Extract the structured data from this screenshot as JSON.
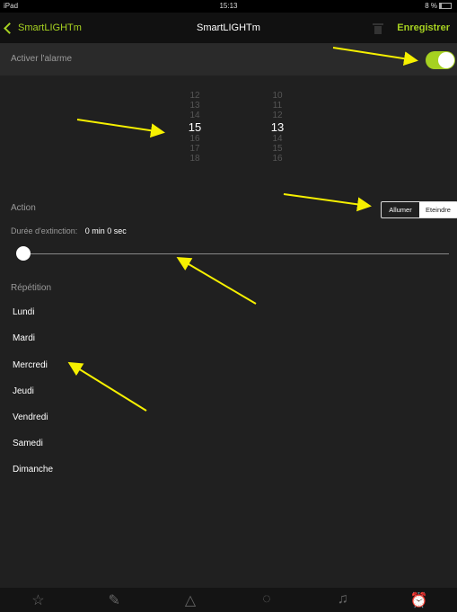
{
  "status_bar": {
    "carrier": "iPad",
    "time": "15:13",
    "battery": "8 %"
  },
  "nav": {
    "back_label": "SmartLIGHTm",
    "title": "SmartLIGHTm",
    "save_label": "Enregistrer"
  },
  "alarm": {
    "label": "Activer l'alarme",
    "enabled": true
  },
  "time_picker": {
    "hours": [
      "12",
      "13",
      "14",
      "15",
      "16",
      "17",
      "18"
    ],
    "minutes": [
      "10",
      "11",
      "12",
      "13",
      "14",
      "15",
      "16"
    ],
    "selected_hour": "15",
    "selected_minute": "13"
  },
  "action": {
    "label": "Action",
    "options": [
      "Allumer",
      "Eteindre"
    ],
    "selected": "Allumer"
  },
  "duration": {
    "label": "Durée d'extinction:",
    "value": "0 min 0 sec",
    "slider_fraction": 0
  },
  "repetition": {
    "label": "Répétition",
    "days": [
      "Lundi",
      "Mardi",
      "Mercredi",
      "Jeudi",
      "Vendredi",
      "Samedi",
      "Dimanche"
    ]
  },
  "tabs": [
    {
      "icon": "star-icon",
      "glyph": "☆"
    },
    {
      "icon": "pencil-icon",
      "glyph": "✎"
    },
    {
      "icon": "triangle-icon",
      "glyph": "△"
    },
    {
      "icon": "cycle-icon",
      "glyph": "◌"
    },
    {
      "icon": "music-note-icon",
      "glyph": "♫"
    },
    {
      "icon": "alarm-clock-icon",
      "glyph": "⏰"
    }
  ],
  "colors": {
    "accent": "#a6d121",
    "annotation": "#f6f000",
    "background": "#202020"
  }
}
